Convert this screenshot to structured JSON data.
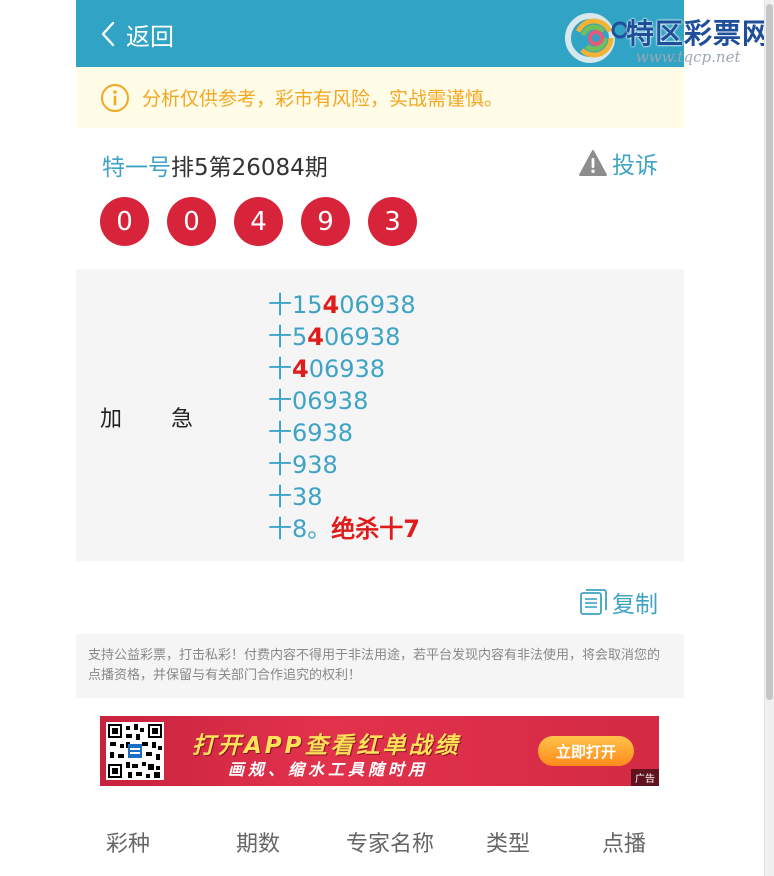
{
  "header": {
    "back_label": "返回",
    "watermark_brand": "特区彩票网",
    "watermark_url": "www.tqcp.net",
    "bg_color": "#31a3c4"
  },
  "notice": {
    "text": "分析仅供参考，彩市有风险，实战需谨慎。",
    "color": "#f5a623",
    "icon": "info-circle-icon"
  },
  "post": {
    "expert_name": "特一号",
    "period_text": "排5第26084期",
    "complain_label": "投诉",
    "complain_icon": "warning-triangle-icon",
    "balls": [
      "0",
      "0",
      "4",
      "9",
      "3"
    ],
    "ball_color": "#d8243a"
  },
  "content": {
    "label_left": "加",
    "label_right": "急",
    "lines": [
      {
        "prefix": "十15",
        "hl": "4",
        "suffix": "06938",
        "tail": ""
      },
      {
        "prefix": "十5",
        "hl": "4",
        "suffix": "06938",
        "tail": ""
      },
      {
        "prefix": "十",
        "hl": "4",
        "suffix": "06938",
        "tail": ""
      },
      {
        "prefix": "十06938",
        "hl": "",
        "suffix": "",
        "tail": ""
      },
      {
        "prefix": "十6938",
        "hl": "",
        "suffix": "",
        "tail": ""
      },
      {
        "prefix": "十938",
        "hl": "",
        "suffix": "",
        "tail": ""
      },
      {
        "prefix": "十38",
        "hl": "",
        "suffix": "",
        "tail": ""
      },
      {
        "prefix": "十8。",
        "hl": "",
        "suffix": "",
        "tail": "绝杀十7"
      }
    ]
  },
  "copy": {
    "label": "复制",
    "icon": "copy-document-icon"
  },
  "disclaimer": "支持公益彩票，打击私彩！付费内容不得用于非法用途，若平台发现内容有非法使用，将会取消您的点播资格，并保留与有关部门合作追究的权利！",
  "ad": {
    "line1": "打开APP查看红单战绩",
    "line2": "画规、缩水工具随时用",
    "button": "立即打开",
    "tag": "广告"
  },
  "table": {
    "headers": [
      "彩种",
      "期数",
      "专家名称",
      "类型",
      "点播"
    ]
  }
}
